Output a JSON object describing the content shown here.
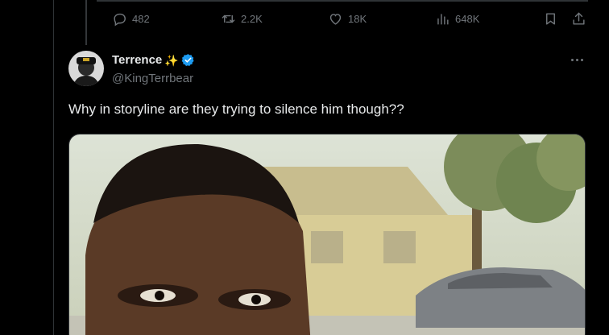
{
  "previous_tweet": {
    "actions": {
      "replies": "482",
      "reposts": "2.2K",
      "likes": "18K",
      "views": "648K"
    }
  },
  "tweet": {
    "display_name": "Terrence",
    "name_emoji": "✨",
    "verified": true,
    "handle": "@KingTerrbear",
    "text": "Why in storyline are they trying to silence him though??",
    "media_description": "photo"
  },
  "colors": {
    "background": "#000000",
    "text_primary": "#e7e9ea",
    "text_secondary": "#71767b",
    "verified_blue": "#1d9bf0",
    "sparkle_yellow": "#f5c518",
    "border": "#2f3336"
  },
  "icons": {
    "reply": "reply-icon",
    "repost": "repost-icon",
    "like": "heart-icon",
    "views": "views-chart-icon",
    "bookmark": "bookmark-icon",
    "share": "share-icon",
    "more": "more-icon",
    "verified": "verified-badge-icon"
  }
}
